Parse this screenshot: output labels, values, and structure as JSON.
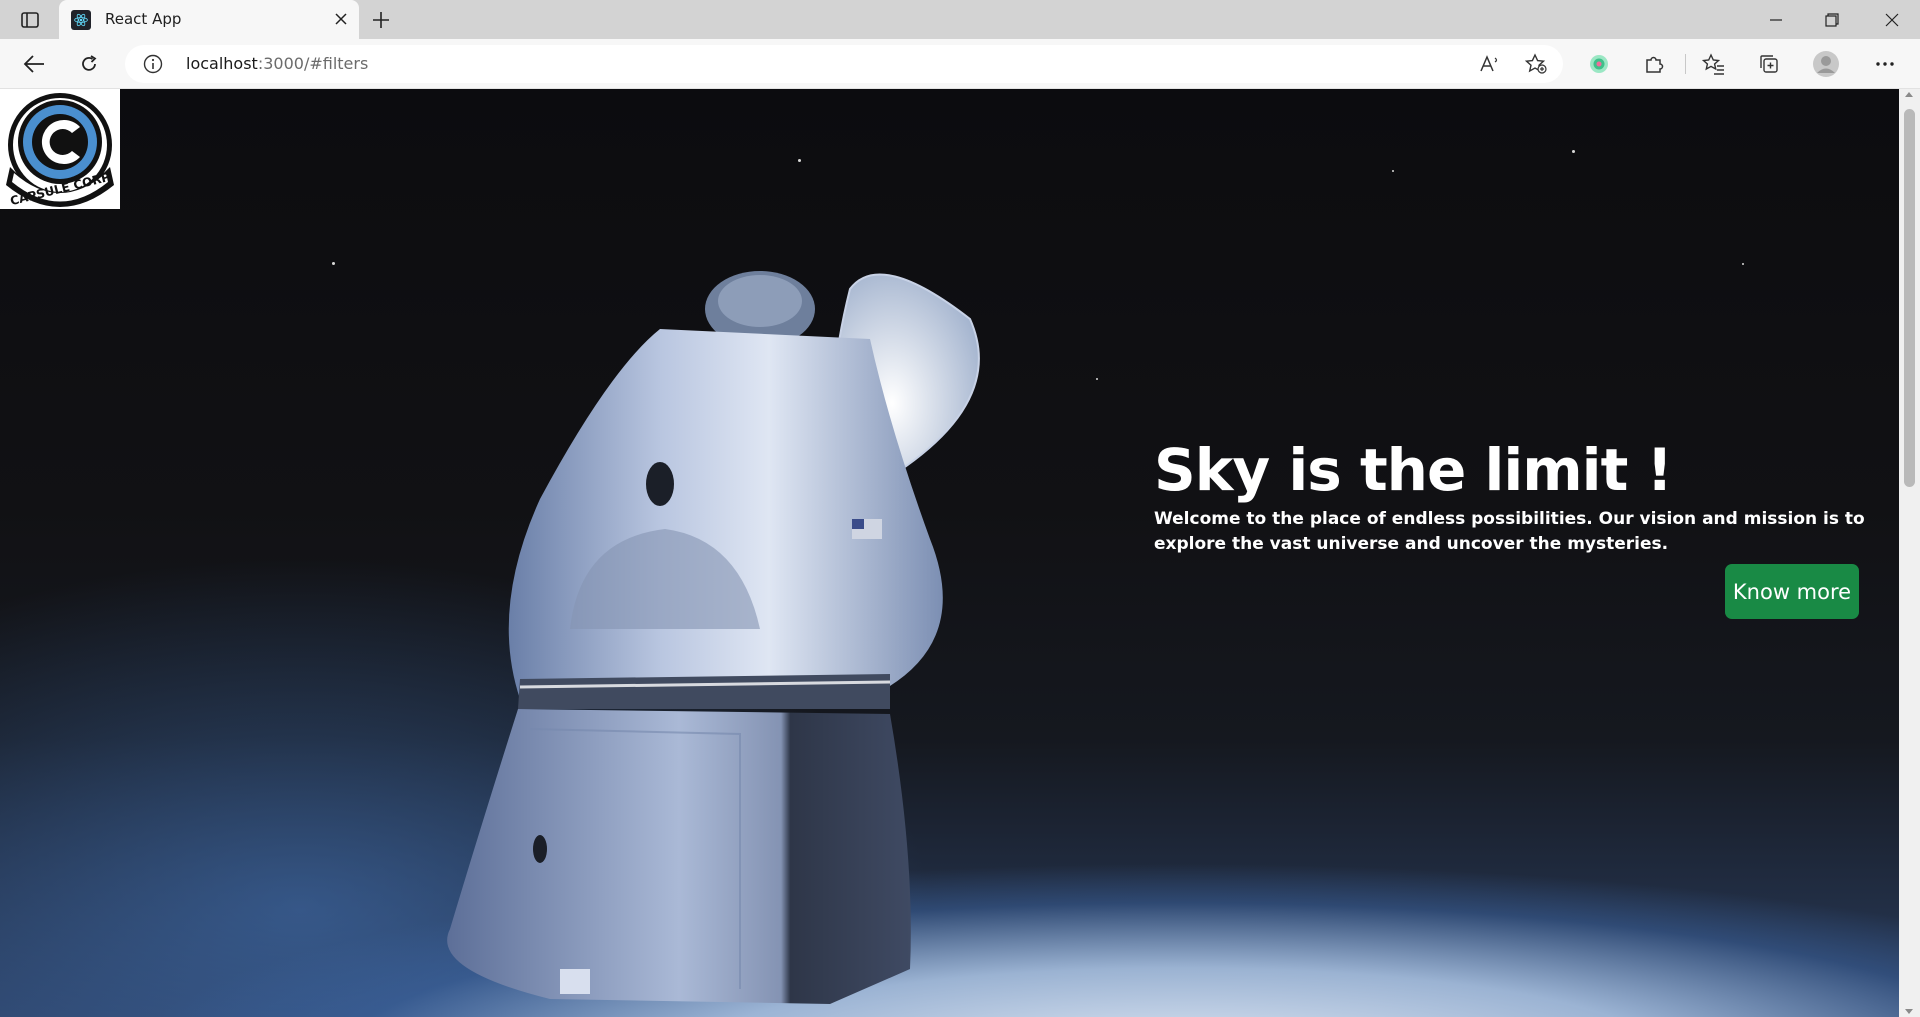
{
  "browser": {
    "tab": {
      "title": "React App"
    },
    "address": {
      "host": "localhost",
      "path": ":3000/#filters"
    },
    "icons": [
      "tab-actions-icon",
      "react-favicon",
      "close-icon",
      "plus-icon",
      "minimize-icon",
      "restore-icon",
      "close-window-icon",
      "back-arrow-icon",
      "reload-icon",
      "info-icon",
      "read-aloud-icon",
      "add-favorite-icon",
      "extension-colorful-icon",
      "puzzle-icon",
      "favorites-icon",
      "collections-icon",
      "profile-icon",
      "more-icon"
    ]
  },
  "page": {
    "logo": {
      "text": "CAPSULE CORP"
    },
    "hero": {
      "title": "Sky is the limit !",
      "description": "Welcome to the place of endless possibilities. Our vision and mission is to explore the vast universe and uncover the mysteries.",
      "button_label": "Know more"
    },
    "colors": {
      "button": "#198a45",
      "tab_bar": "#d3d3d3",
      "toolbar": "#f7f7f7",
      "logo_blue": "#4a8fcf"
    }
  }
}
